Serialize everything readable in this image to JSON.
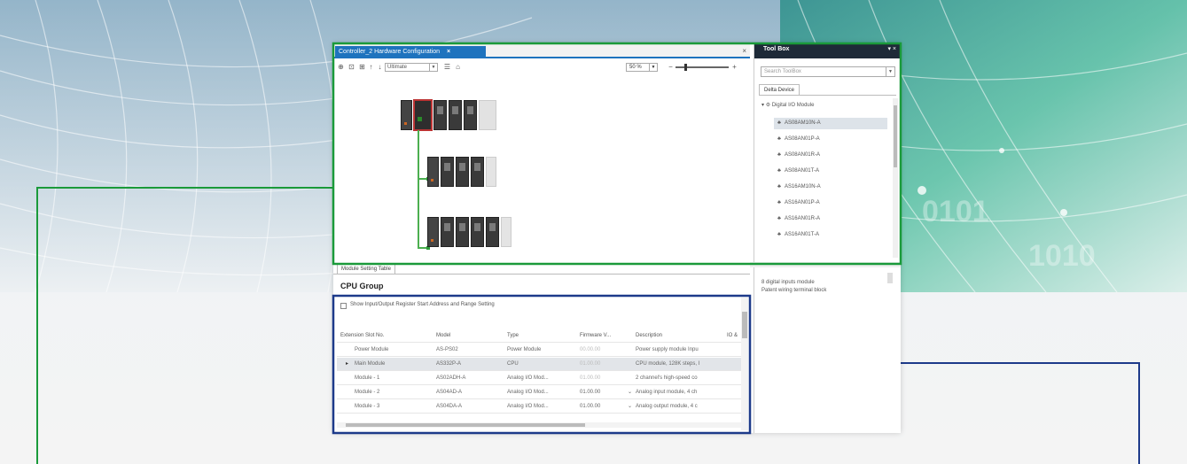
{
  "colors": {
    "highlight_green": "#1a9a3a",
    "highlight_blue": "#1d3a8a",
    "tab_blue": "#1e73be",
    "bus_green": "#4caf50"
  },
  "editor": {
    "tab_title": "Controller_2 Hardware Configuration",
    "tab_close": "×",
    "window_close": "×",
    "toolbar": {
      "icons": [
        "zoom-in-icon",
        "zoom-fit-icon",
        "grid-icon",
        "move-up-icon",
        "move-down-icon",
        "home-icon"
      ],
      "view_select": "Ultimate",
      "zoom_value": "50 %"
    }
  },
  "toolbox": {
    "title": "Tool Box",
    "pin": "▾",
    "close": "×",
    "search_placeholder": "Search ToolBox",
    "tab": "Delta Device",
    "category": "Digital I/O Module",
    "items": [
      "AS08AM10N-A",
      "AS08AN01P-A",
      "AS08AN01R-A",
      "AS08AN01T-A",
      "AS16AM10N-A",
      "AS16AN01P-A",
      "AS16AN01R-A",
      "AS16AN01T-A"
    ],
    "selected_index": 0
  },
  "module_table": {
    "tab": "Module Setting Table",
    "group_title": "CPU Group",
    "checkbox_label": "Show Input/Output Register Start Address and Range Setting",
    "columns": [
      "Extension Slot No.",
      "Model",
      "Type",
      "Firmware V...",
      "Description",
      "IO &"
    ],
    "rows": [
      {
        "slot": "Power Module",
        "model": "AS-PS02",
        "type": "Power Module",
        "firmware": "00.00.00",
        "description": "Power supply module Inpu"
      },
      {
        "slot": "Main Module",
        "model": "AS332P-A",
        "type": "CPU",
        "firmware": "01.00.00",
        "description": "CPU module, 128K steps, I"
      },
      {
        "slot": "Module - 1",
        "model": "AS02ADH-A",
        "type": "Analog I/O Mod...",
        "firmware": "01.00.00",
        "description": "2 channel's high-speed co"
      },
      {
        "slot": "Module - 2",
        "model": "AS04AD-A",
        "type": "Analog I/O Mod...",
        "firmware": "01.00.00",
        "description": "Analog input module, 4 ch"
      },
      {
        "slot": "Module - 3",
        "model": "AS04DA-A",
        "type": "Analog I/O Mod...",
        "firmware": "01.00.00",
        "description": "Analog output module, 4 c"
      }
    ],
    "selected_row": 1,
    "row_pointer": "▸"
  },
  "description_panel": {
    "lines": [
      "8 digital inputs module",
      "Patent wiring terminal block"
    ]
  }
}
